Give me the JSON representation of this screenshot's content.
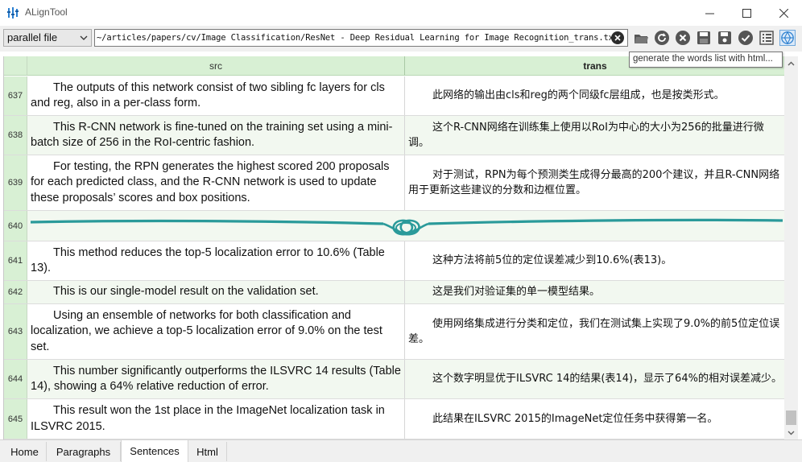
{
  "window": {
    "title": "ALignTool",
    "minimize_label": "minimize",
    "maximize_label": "maximize",
    "close_label": "close"
  },
  "toolbar": {
    "mode_select_value": "parallel file",
    "file_path": "~/articles/papers/cv/Image Classification/ResNet - Deep Residual Learning for Image Recognition_trans.txt",
    "buttons": [
      "folder-open-icon",
      "refresh-icon",
      "close-circle-icon",
      "save-as-icon",
      "save-icon",
      "check-icon",
      "list-icon",
      "word-list-icon"
    ],
    "tooltip": "generate the words list with html..."
  },
  "grid": {
    "columns": {
      "src": "src",
      "trans": "trans"
    },
    "rows": [
      {
        "num": "637",
        "src": "The outputs of this network consist of two sibling fc layers for cls and reg, also in a per-class form.",
        "trans": "此网络的输出由cls和reg的两个同级fc层组成，也是按类形式。"
      },
      {
        "num": "638",
        "src": "This R-CNN network is fine-tuned on the training set using a mini-batch size of 256 in the RoI-centric fashion.",
        "trans": "这个R-CNN网络在训练集上使用以RoI为中心的大小为256的批量进行微调。"
      },
      {
        "num": "639",
        "src": "For testing, the RPN generates the highest scored 200 proposals for each predicted class, and the R-CNN network is used to update these proposals’   scores and box positions.",
        "trans": "对于测试，RPN为每个预测类生成得分最高的200个建议，并且R-CNN网络用于更新这些建议的分数和边框位置。"
      },
      {
        "num": "640",
        "src": "",
        "trans": ""
      },
      {
        "num": "641",
        "src": "This method reduces the top-5 localization error to 10.6% (Table 13).",
        "trans": "这种方法将前5位的定位误差减少到10.6%(表13)。"
      },
      {
        "num": "642",
        "src": "This is our single-model result on the validation set.",
        "trans": "这是我们对验证集的单一模型结果。"
      },
      {
        "num": "643",
        "src": "Using an ensemble of networks for both classification and localization, we achieve a top-5 localization error of 9.0% on the test set.",
        "trans": "使用网络集成进行分类和定位，我们在测试集上实现了9.0%的前5位定位误差。"
      },
      {
        "num": "644",
        "src": "This number significantly outperforms the ILSVRC 14 results (Table 14), showing a 64% relative reduction of error.",
        "trans": "这个数字明显优于ILSVRC 14的结果(表14)，显示了64%的相对误差减少。"
      },
      {
        "num": "645",
        "src": "This result won the 1st place in the ImageNet localization task in ILSVRC 2015.",
        "trans": "此结果在ILSVRC 2015的ImageNet定位任务中获得第一名。"
      }
    ]
  },
  "tabs": [
    {
      "label": "Home",
      "active": false
    },
    {
      "label": "Paragraphs",
      "active": false
    },
    {
      "label": "Sentences",
      "active": true
    },
    {
      "label": "Html",
      "active": false
    }
  ],
  "colors": {
    "header_green": "#d8f0d4",
    "divider_teal": "#2a9a9a",
    "alt_row": "#f2f8f0"
  }
}
